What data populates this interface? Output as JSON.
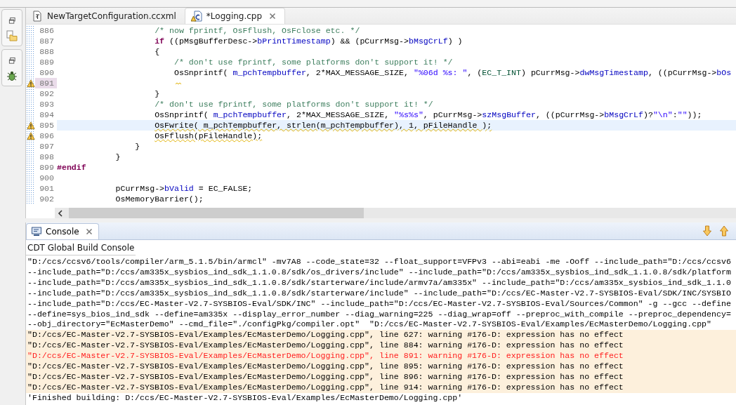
{
  "editor": {
    "tabs": [
      {
        "label": "NewTargetConfiguration.ccxml",
        "selected": false,
        "kind": "xml"
      },
      {
        "label": "*Logging.cpp",
        "selected": true,
        "kind": "cpp"
      }
    ],
    "lines": [
      {
        "number": "886",
        "tokens": [
          {
            "kind": "comment",
            "text": "                    /* now fprintf, OsFflush, OsFclose etc. */"
          }
        ]
      },
      {
        "number": "887",
        "tokens": [
          {
            "kind": "keyword",
            "text": "                    if"
          },
          {
            "kind": "plain",
            "text": " ((pMsgBufferDesc->"
          },
          {
            "kind": "field",
            "text": "bPrintTimestamp"
          },
          {
            "kind": "plain",
            "text": ") && (pCurrMsg->"
          },
          {
            "kind": "field",
            "text": "bMsgCrLf"
          },
          {
            "kind": "plain",
            "text": ") )"
          }
        ]
      },
      {
        "number": "888",
        "tokens": [
          {
            "kind": "plain",
            "text": "                    {"
          }
        ]
      },
      {
        "number": "889",
        "tokens": [
          {
            "kind": "comment",
            "text": "                        /* don't use fprintf, some platforms don't support it! */"
          }
        ]
      },
      {
        "number": "890",
        "tokens": [
          {
            "kind": "plain",
            "text": "                        OsSnprintf( "
          },
          {
            "kind": "field",
            "text": "m_pchTempbuffer"
          },
          {
            "kind": "plain",
            "text": ", 2*MAX_MESSAGE_SIZE, "
          },
          {
            "kind": "string",
            "text": "\"%06d %s: \""
          },
          {
            "kind": "plain",
            "text": ", ("
          },
          {
            "kind": "type",
            "text": "EC_T_INT"
          },
          {
            "kind": "plain",
            "text": ") pCurrMsg->"
          },
          {
            "kind": "field",
            "text": "dwMsgTimestamp"
          },
          {
            "kind": "plain",
            "text": ", ((pCurrMsg->"
          },
          {
            "kind": "field",
            "text": "bOs"
          }
        ]
      },
      {
        "number": "891",
        "warning": true,
        "squiggle": true,
        "marked": true
      },
      {
        "number": "892",
        "tokens": [
          {
            "kind": "plain",
            "text": "                    }"
          }
        ]
      },
      {
        "number": "893",
        "tokens": [
          {
            "kind": "comment",
            "text": "                    /* don't use fprintf, some platforms don't support it! */"
          }
        ]
      },
      {
        "number": "894",
        "tokens": [
          {
            "kind": "plain",
            "text": "                    OsSnprintf( "
          },
          {
            "kind": "field",
            "text": "m_pchTempbuffer"
          },
          {
            "kind": "plain",
            "text": ", 2*MAX_MESSAGE_SIZE, "
          },
          {
            "kind": "string",
            "text": "\"%s%s\""
          },
          {
            "kind": "plain",
            "text": ", pCurrMsg->"
          },
          {
            "kind": "field",
            "text": "szMsgBuffer"
          },
          {
            "kind": "plain",
            "text": ", ((pCurrMsg->"
          },
          {
            "kind": "field",
            "text": "bMsgCrLf"
          },
          {
            "kind": "plain",
            "text": ")?"
          },
          {
            "kind": "string",
            "text": "\"\\n\""
          },
          {
            "kind": "plain",
            "text": ":"
          },
          {
            "kind": "string",
            "text": "\"\""
          },
          {
            "kind": "plain",
            "text": "));"
          }
        ]
      },
      {
        "number": "895",
        "warning": true,
        "squiggle": true,
        "current": true,
        "tokens": [
          {
            "kind": "plain",
            "text": "                    OsFwrite( m_pchTempbuffer, strlen(m_pchTempbuffer), 1, pFileHandle );"
          }
        ]
      },
      {
        "number": "896",
        "warning": true,
        "squiggle": true,
        "tokens": [
          {
            "kind": "plain",
            "text": "                    OsFflush(pFileHandle);"
          }
        ]
      },
      {
        "number": "897",
        "tokens": [
          {
            "kind": "plain",
            "text": "                }"
          }
        ]
      },
      {
        "number": "898",
        "tokens": [
          {
            "kind": "plain",
            "text": "            }"
          }
        ]
      },
      {
        "number": "899",
        "tokens": [
          {
            "kind": "preproc",
            "text": "#endif"
          }
        ]
      },
      {
        "number": "900"
      },
      {
        "number": "901",
        "tokens": [
          {
            "kind": "plain",
            "text": "            pCurrMsg->"
          },
          {
            "kind": "field",
            "text": "bValid"
          },
          {
            "kind": "plain",
            "text": " = EC_FALSE;"
          }
        ]
      },
      {
        "number": "902",
        "tokens": [
          {
            "kind": "plain",
            "text": "            OsMemoryBarrier();"
          }
        ]
      }
    ]
  },
  "console": {
    "tab": "Console",
    "title": "CDT Global Build Console",
    "lines": [
      {
        "kind": "info",
        "text": "\"D:/ccs/ccsv6/tools/compiler/arm_5.1.5/bin/armcl\" -mv7A8 --code_state=32 --float_support=VFPv3 --abi=eabi -me -Ooff --include_path=\"D:/ccs/ccsv6"
      },
      {
        "kind": "info",
        "text": "--include_path=\"D:/ccs/am335x_sysbios_ind_sdk_1.1.0.8/sdk/os_drivers/include\" --include_path=\"D:/ccs/am335x_sysbios_ind_sdk_1.1.0.8/sdk/platform"
      },
      {
        "kind": "info",
        "text": "--include_path=\"D:/ccs/am335x_sysbios_ind_sdk_1.1.0.8/sdk/starterware/include/armv7a/am335x\" --include_path=\"D:/ccs/am335x_sysbios_ind_sdk_1.1.0"
      },
      {
        "kind": "info",
        "text": "--include_path=\"D:/ccs/am335x_sysbios_ind_sdk_1.1.0.8/sdk/starterware/include\" --include_path=\"D:/ccs/EC-Master-V2.7-SYSBIOS-Eval/SDK/INC/SYSBIO"
      },
      {
        "kind": "info",
        "text": "--include_path=\"D:/ccs/EC-Master-V2.7-SYSBIOS-Eval/SDK/INC\" --include_path=\"D:/ccs/EC-Master-V2.7-SYSBIOS-Eval/Sources/Common\" -g --gcc --define"
      },
      {
        "kind": "info",
        "text": "--define=sys_bios_ind_sdk --define=am335x --display_error_number --diag_warning=225 --diag_wrap=off --preproc_with_compile --preproc_dependency="
      },
      {
        "kind": "info",
        "text": "--obj_directory=\"EcMasterDemo\" --cmd_file=\"./configPkg/compiler.opt\"  \"D:/ccs/EC-Master-V2.7-SYSBIOS-Eval/Examples/EcMasterDemo/Logging.cpp\""
      },
      {
        "kind": "warning",
        "selected": false,
        "text": "\"D:/ccs/EC-Master-V2.7-SYSBIOS-Eval/Examples/EcMasterDemo/Logging.cpp\", line 627: warning #176-D: expression has no effect"
      },
      {
        "kind": "warning",
        "selected": false,
        "text": "\"D:/ccs/EC-Master-V2.7-SYSBIOS-Eval/Examples/EcMasterDemo/Logging.cpp\", line 884: warning #176-D: expression has no effect"
      },
      {
        "kind": "warning",
        "selected": true,
        "text": "\"D:/ccs/EC-Master-V2.7-SYSBIOS-Eval/Examples/EcMasterDemo/Logging.cpp\", line 891: warning #176-D: expression has no effect"
      },
      {
        "kind": "warning",
        "selected": false,
        "text": "\"D:/ccs/EC-Master-V2.7-SYSBIOS-Eval/Examples/EcMasterDemo/Logging.cpp\", line 895: warning #176-D: expression has no effect"
      },
      {
        "kind": "warning",
        "selected": false,
        "text": "\"D:/ccs/EC-Master-V2.7-SYSBIOS-Eval/Examples/EcMasterDemo/Logging.cpp\", line 896: warning #176-D: expression has no effect"
      },
      {
        "kind": "warning",
        "selected": false,
        "text": "\"D:/ccs/EC-Master-V2.7-SYSBIOS-Eval/Examples/EcMasterDemo/Logging.cpp\", line 914: warning #176-D: expression has no effect"
      },
      {
        "kind": "info",
        "text": "'Finished building: D:/ccs/EC-Master-V2.7-SYSBIOS-Eval/Examples/EcMasterDemo/Logging.cpp'"
      }
    ]
  }
}
